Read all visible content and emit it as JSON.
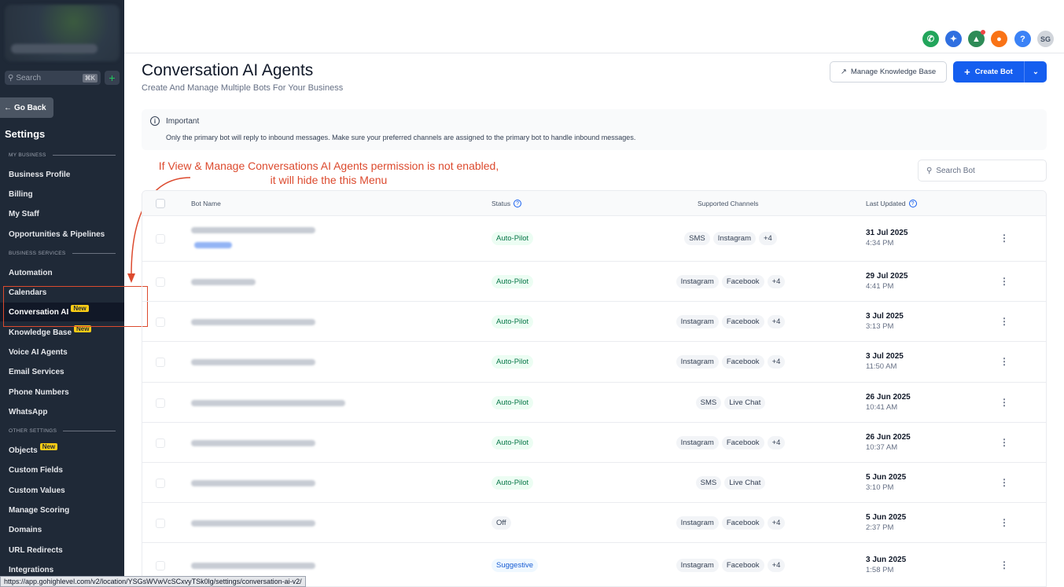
{
  "sidebar": {
    "search_placeholder": "Search",
    "search_shortcut": "⌘K",
    "go_back": "Go Back",
    "settings_title": "Settings",
    "sections": {
      "my_business": "MY BUSINESS",
      "business_services": "BUSINESS SERVICES",
      "other_settings": "OTHER SETTINGS"
    },
    "items": {
      "business_profile": "Business Profile",
      "billing": "Billing",
      "my_staff": "My Staff",
      "opportunities": "Opportunities & Pipelines",
      "automation": "Automation",
      "calendars": "Calendars",
      "conversation_ai": "Conversation AI",
      "knowledge_base": "Knowledge Base",
      "voice_ai": "Voice AI Agents",
      "email_services": "Email Services",
      "phone_numbers": "Phone Numbers",
      "whatsapp": "WhatsApp",
      "objects": "Objects",
      "custom_fields": "Custom Fields",
      "custom_values": "Custom Values",
      "manage_scoring": "Manage Scoring",
      "domains": "Domains",
      "url_redirects": "URL Redirects",
      "integrations": "Integrations"
    },
    "new_badge": "New"
  },
  "topbar": {
    "avatar_initials": "SG",
    "help_label": "?",
    "colors": {
      "phone": "#22a55b",
      "magic": "#2f6fe0",
      "megaphone": "#2e8b57",
      "bell": "#f97316",
      "help": "#3b82f6",
      "avatar": "#d1d5db"
    }
  },
  "header": {
    "title": "Conversation AI Agents",
    "subtitle": "Create And Manage Multiple Bots For Your Business",
    "manage_kb": "Manage Knowledge Base",
    "create_bot": "Create Bot"
  },
  "info": {
    "title": "Important",
    "text": "Only the primary bot will reply to inbound messages. Make sure your preferred channels are assigned to the primary bot to handle inbound messages."
  },
  "annotation": {
    "line1": "If View & Manage Conversations AI Agents permission is not enabled,",
    "line2": "it will hide the this Menu"
  },
  "search_bot_placeholder": "Search Bot",
  "table": {
    "headers": {
      "bot_name": "Bot Name",
      "status": "Status",
      "channels": "Supported Channels",
      "last_updated": "Last Updated"
    },
    "rows": [
      {
        "status": "Auto-Pilot",
        "status_type": "auto",
        "channels": [
          "SMS",
          "Instagram",
          "+4"
        ],
        "date": "31 Jul 2025",
        "time": "4:34 PM"
      },
      {
        "status": "Auto-Pilot",
        "status_type": "auto",
        "channels": [
          "Instagram",
          "Facebook",
          "+4"
        ],
        "date": "29 Jul 2025",
        "time": "4:41 PM"
      },
      {
        "status": "Auto-Pilot",
        "status_type": "auto",
        "channels": [
          "Instagram",
          "Facebook",
          "+4"
        ],
        "date": "3 Jul 2025",
        "time": "3:13 PM"
      },
      {
        "status": "Auto-Pilot",
        "status_type": "auto",
        "channels": [
          "Instagram",
          "Facebook",
          "+4"
        ],
        "date": "3 Jul 2025",
        "time": "11:50 AM"
      },
      {
        "status": "Auto-Pilot",
        "status_type": "auto",
        "channels": [
          "SMS",
          "Live Chat"
        ],
        "date": "26 Jun 2025",
        "time": "10:41 AM"
      },
      {
        "status": "Auto-Pilot",
        "status_type": "auto",
        "channels": [
          "Instagram",
          "Facebook",
          "+4"
        ],
        "date": "26 Jun 2025",
        "time": "10:37 AM"
      },
      {
        "status": "Auto-Pilot",
        "status_type": "auto",
        "channels": [
          "SMS",
          "Live Chat"
        ],
        "date": "5 Jun 2025",
        "time": "3:10 PM"
      },
      {
        "status": "Off",
        "status_type": "off",
        "channels": [
          "Instagram",
          "Facebook",
          "+4"
        ],
        "date": "5 Jun 2025",
        "time": "2:37 PM"
      },
      {
        "status": "Suggestive",
        "status_type": "sugg",
        "channels": [
          "Instagram",
          "Facebook",
          "+4"
        ],
        "date": "3 Jun 2025",
        "time": "1:58 PM"
      }
    ]
  },
  "status_bar_url": "https://app.gohighlevel.com/v2/location/YSGsWVwVcSCxvyTSk0lg/settings/conversation-ai-v2/"
}
